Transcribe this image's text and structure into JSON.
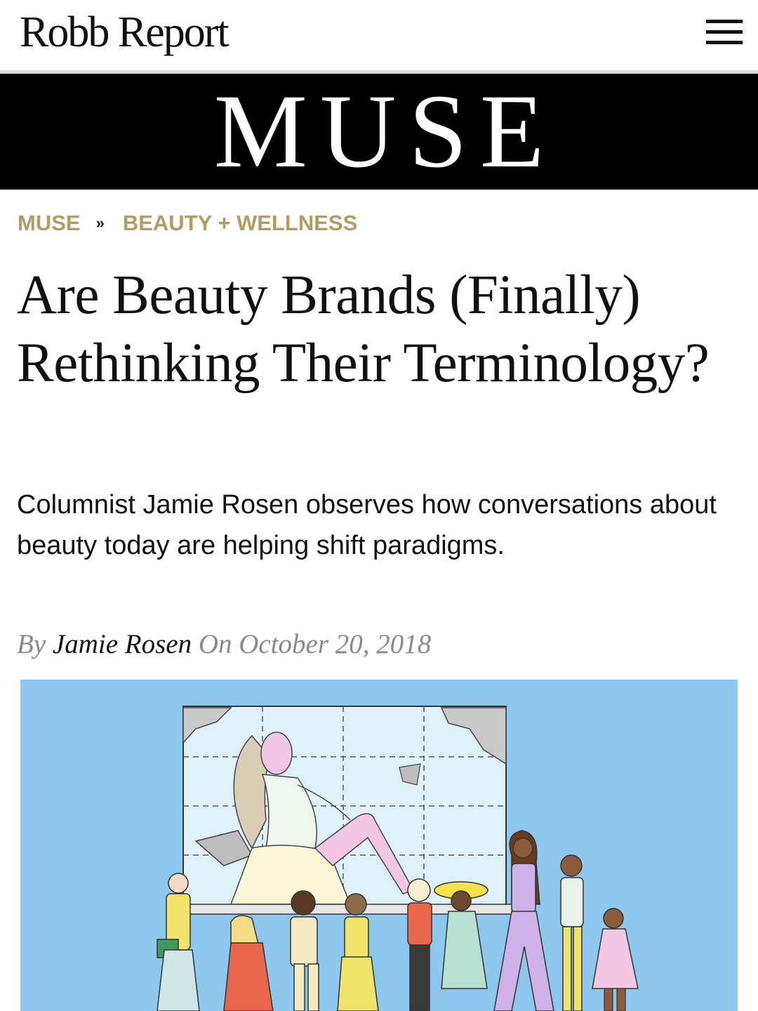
{
  "header": {
    "logo_text": "Robb Report",
    "menu_icon": "hamburger-menu-icon"
  },
  "banner": {
    "title": "MUSE"
  },
  "breadcrumb": {
    "items": [
      {
        "label": "MUSE"
      },
      {
        "label": "BEAUTY + WELLNESS"
      }
    ],
    "separator": "»"
  },
  "article": {
    "headline": "Are Beauty Brands (Finally) Rethinking Their Terminology?",
    "dek": "Columnist Jamie Rosen observes how conversations about beauty today are helping shift paradigms.",
    "byline": {
      "by": "By",
      "author": "Jamie Rosen",
      "on": "On",
      "date": "October 20, 2018"
    }
  },
  "colors": {
    "accent_gold": "#b59a62",
    "banner_bg": "#000000",
    "hero_sky": "#8ec8ee"
  }
}
